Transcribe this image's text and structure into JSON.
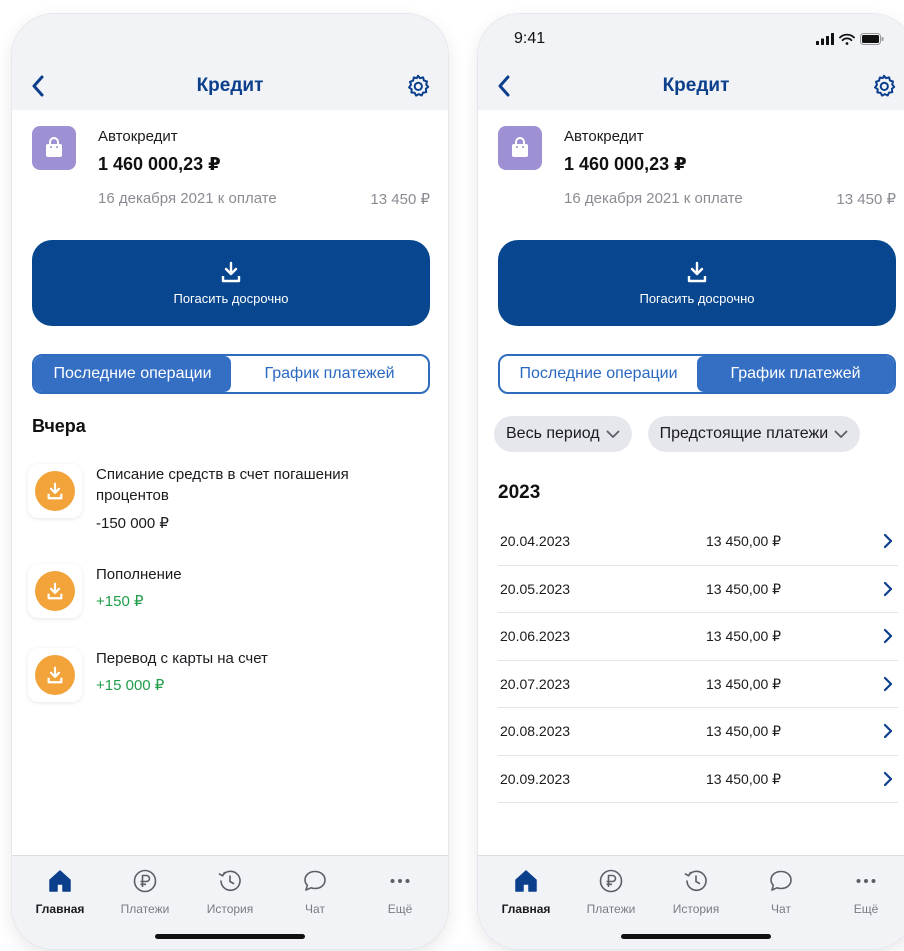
{
  "status": {
    "time": "9:41"
  },
  "nav": {
    "title": "Кредит"
  },
  "loan": {
    "name": "Автокредит",
    "amount": "1 460 000,23 ₽",
    "due_text": "16 декабря 2021 к оплате",
    "due_amount": "13 450 ₽"
  },
  "payoff": {
    "label": "Погасить досрочно"
  },
  "segments": {
    "operations": "Последние операции",
    "schedule": "График платежей"
  },
  "operations": {
    "section_title": "Вчера",
    "items": [
      {
        "title": "Списание средств в счет погашения процентов",
        "amount": "-150 000 ₽"
      },
      {
        "title": "Пополнение",
        "amount": "+150 ₽"
      },
      {
        "title": "Перевод с карты на счет",
        "amount": "+15 000 ₽"
      }
    ]
  },
  "filters": {
    "period": "Весь период",
    "type": "Предстоящие платежи"
  },
  "schedule": {
    "year": "2023",
    "rows": [
      {
        "date": "20.04.2023",
        "amount": "13 450,00 ₽"
      },
      {
        "date": "20.05.2023",
        "amount": "13 450,00 ₽"
      },
      {
        "date": "20.06.2023",
        "amount": "13 450,00 ₽"
      },
      {
        "date": "20.07.2023",
        "amount": "13 450,00 ₽"
      },
      {
        "date": "20.08.2023",
        "amount": "13 450,00 ₽"
      },
      {
        "date": "20.09.2023",
        "amount": "13 450,00 ₽"
      }
    ]
  },
  "tabbar": {
    "items": [
      {
        "label": "Главная",
        "icon": "home-icon"
      },
      {
        "label": "Платежи",
        "icon": "ruble-icon"
      },
      {
        "label": "История",
        "icon": "history-icon"
      },
      {
        "label": "Чат",
        "icon": "chat-icon"
      },
      {
        "label": "Ещё",
        "icon": "more-icon"
      }
    ]
  },
  "colors": {
    "primary": "#08478f",
    "segment_active": "#356fc3",
    "title": "#0b3f8c",
    "operation_icon": "#f2a33a",
    "positive": "#1f9d4a",
    "loan_icon": "#9f8fd3"
  }
}
